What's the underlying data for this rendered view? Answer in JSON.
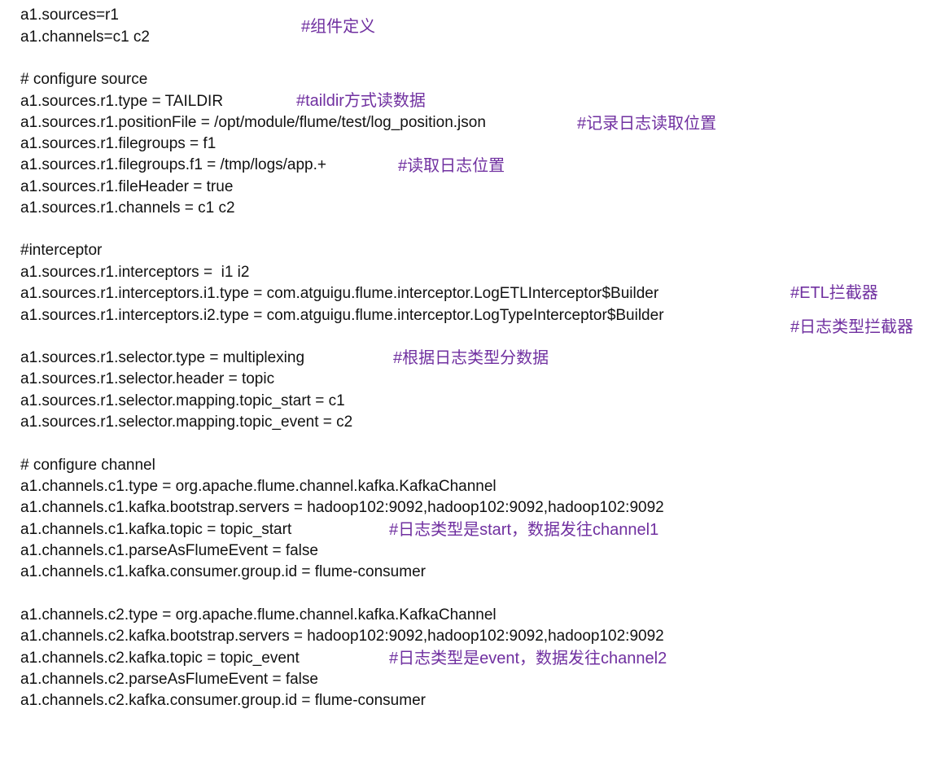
{
  "comment_color": "#7030a0",
  "text_color": "#111111",
  "code_lines": [
    "a1.sources=r1",
    "a1.channels=c1 c2",
    "# configure source",
    "a1.sources.r1.type = TAILDIR",
    "a1.sources.r1.positionFile = /opt/module/flume/test/log_position.json",
    "a1.sources.r1.filegroups = f1",
    "a1.sources.r1.filegroups.f1 = /tmp/logs/app.+",
    "a1.sources.r1.fileHeader = true",
    "a1.sources.r1.channels = c1 c2",
    "#interceptor",
    "a1.sources.r1.interceptors =  i1 i2",
    "a1.sources.r1.interceptors.i1.type = com.atguigu.flume.interceptor.LogETLInterceptor$Builder",
    "a1.sources.r1.interceptors.i2.type = com.atguigu.flume.interceptor.LogTypeInterceptor$Builder",
    "a1.sources.r1.selector.type = multiplexing",
    "a1.sources.r1.selector.header = topic",
    "a1.sources.r1.selector.mapping.topic_start = c1",
    "a1.sources.r1.selector.mapping.topic_event = c2",
    "# configure channel",
    "a1.channels.c1.type = org.apache.flume.channel.kafka.KafkaChannel",
    "a1.channels.c1.kafka.bootstrap.servers = hadoop102:9092,hadoop102:9092,hadoop102:9092",
    "a1.channels.c1.kafka.topic = topic_start",
    "a1.channels.c1.parseAsFlumeEvent = false",
    "a1.channels.c1.kafka.consumer.group.id = flume-consumer",
    "a1.channels.c2.type = org.apache.flume.channel.kafka.KafkaChannel",
    "a1.channels.c2.kafka.bootstrap.servers = hadoop102:9092,hadoop102:9092,hadoop102:9092",
    "a1.channels.c2.kafka.topic = topic_event",
    "a1.channels.c2.parseAsFlumeEvent = false",
    "a1.channels.c2.kafka.consumer.group.id = flume-consumer"
  ],
  "comments": [
    "#组件定义",
    "#taildir方式读数据",
    "#记录日志读取位置",
    "#读取日志位置",
    "#ETL拦截器",
    "#日志类型拦截器",
    "#根据日志类型分数据",
    "#日志类型是start，数据发往channel1",
    "#日志类型是event，数据发往channel2"
  ]
}
